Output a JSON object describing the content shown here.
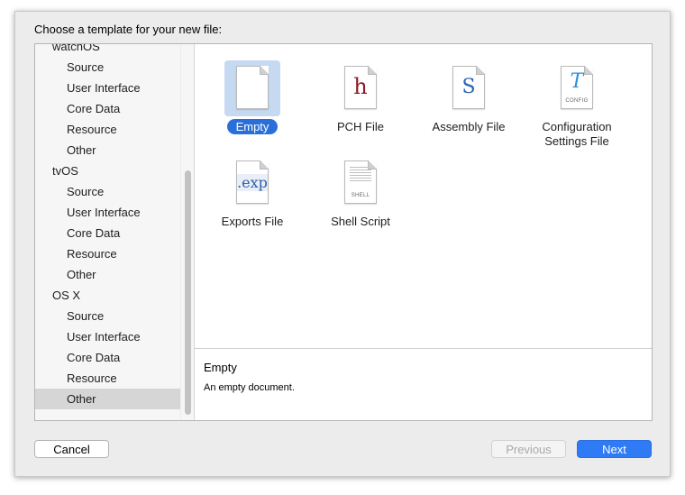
{
  "prompt": "Choose a template for your new file:",
  "sidebar": {
    "items": [
      {
        "label": "watchOS",
        "kind": "platform"
      },
      {
        "label": "Source",
        "kind": "sub"
      },
      {
        "label": "User Interface",
        "kind": "sub"
      },
      {
        "label": "Core Data",
        "kind": "sub"
      },
      {
        "label": "Resource",
        "kind": "sub"
      },
      {
        "label": "Other",
        "kind": "sub"
      },
      {
        "label": "tvOS",
        "kind": "platform"
      },
      {
        "label": "Source",
        "kind": "sub"
      },
      {
        "label": "User Interface",
        "kind": "sub"
      },
      {
        "label": "Core Data",
        "kind": "sub"
      },
      {
        "label": "Resource",
        "kind": "sub"
      },
      {
        "label": "Other",
        "kind": "sub"
      },
      {
        "label": "OS X",
        "kind": "platform"
      },
      {
        "label": "Source",
        "kind": "sub"
      },
      {
        "label": "User Interface",
        "kind": "sub"
      },
      {
        "label": "Core Data",
        "kind": "sub"
      },
      {
        "label": "Resource",
        "kind": "sub"
      },
      {
        "label": "Other",
        "kind": "sub",
        "selected": true
      }
    ]
  },
  "templates": [
    {
      "label": "Empty",
      "icon": "empty-document-icon",
      "selected": true
    },
    {
      "label": "PCH File",
      "icon": "pch-file-icon",
      "glyph": "h"
    },
    {
      "label": "Assembly File",
      "icon": "assembly-file-icon",
      "glyph": "S"
    },
    {
      "label": "Configuration\nSettings File",
      "icon": "configuration-settings-file-icon",
      "glyph": "T",
      "small": "CONFIG"
    },
    {
      "label": "Exports File",
      "icon": "exports-file-icon",
      "glyph": ".exp"
    },
    {
      "label": "Shell Script",
      "icon": "shell-script-icon",
      "small": "SHELL"
    }
  ],
  "description": {
    "title": "Empty",
    "text": "An empty document."
  },
  "buttons": {
    "cancel": "Cancel",
    "previous": "Previous",
    "next": "Next"
  },
  "colors": {
    "accent": "#2f7bf6",
    "selection_highlight": "#2a6fd9"
  }
}
